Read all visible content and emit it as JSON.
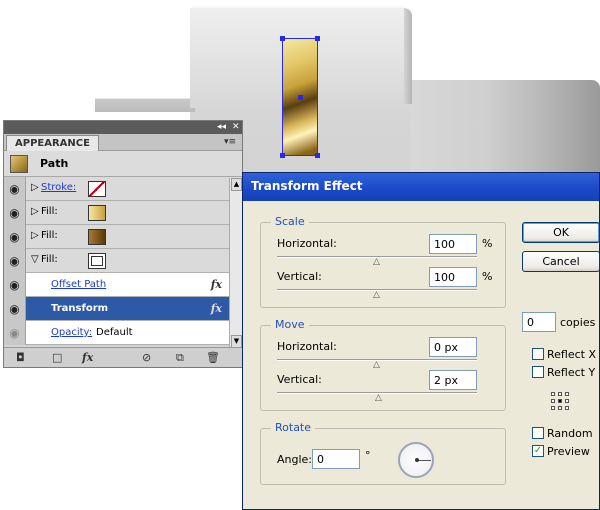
{
  "appearance_panel": {
    "tab_label": "APPEARANCE",
    "object_type": "Path",
    "rows": [
      {
        "label": "Stroke:",
        "swatch": "#ffffff"
      },
      {
        "label": "Fill:",
        "swatch": "#e8c860"
      },
      {
        "label": "Fill:",
        "swatch": "#7a4e12"
      },
      {
        "label": "Fill:",
        "swatch": "#ffffff"
      }
    ],
    "effects": [
      {
        "label": "Offset Path",
        "fx": "fx"
      },
      {
        "label": "Transform",
        "fx": "fx"
      }
    ],
    "opacity_label": "Opacity:",
    "opacity_value": "Default",
    "footer_fx": "fx"
  },
  "dialog": {
    "title": "Transform Effect",
    "scale": {
      "group_label": "Scale",
      "horizontal_label": "Horizontal:",
      "horizontal_value": "100",
      "vertical_label": "Vertical:",
      "vertical_value": "100",
      "unit": "%"
    },
    "move": {
      "group_label": "Move",
      "horizontal_label": "Horizontal:",
      "horizontal_value": "0 px",
      "vertical_label": "Vertical:",
      "vertical_value": "2 px"
    },
    "rotate": {
      "group_label": "Rotate",
      "angle_label": "Angle:",
      "angle_value": "0",
      "degree_symbol": "°"
    },
    "ok_label": "OK",
    "cancel_label": "Cancel",
    "copies_value": "0",
    "copies_label": "copies",
    "reflect_x_label": "Reflect X",
    "reflect_y_label": "Reflect Y",
    "random_label": "Random",
    "preview_label": "Preview",
    "reflect_x_checked": false,
    "reflect_y_checked": false,
    "random_checked": false,
    "preview_checked": true
  },
  "colors": {
    "selection": "#2a2ae6",
    "dialog_title": "#1a48c8",
    "panel_selected_row": "#2d5aa6"
  }
}
